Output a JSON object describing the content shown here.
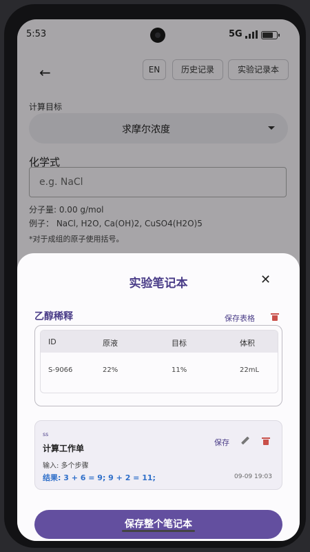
{
  "status_bar": {
    "time": "5:53",
    "network": "5G"
  },
  "header": {
    "back_icon": "arrow-left-icon",
    "back_glyph": "←",
    "chips": {
      "lang": "EN",
      "history": "历史记录",
      "notebook": "实验记录本"
    }
  },
  "form": {
    "target_label": "计算目标",
    "target_value": "求摩尔浓度",
    "formula_label": "化学式",
    "formula_placeholder": "e.g. NaCl",
    "molar_mass": "分子量: 0.00 g/mol",
    "examples": "例子： NaCl, H2O, Ca(OH)2, CuSO4(H2O)5",
    "note": "*对于成组的原子使用括号。"
  },
  "sheet": {
    "title": "实验笔记本",
    "close_glyph": "✕",
    "table_section": {
      "title": "乙醇稀释",
      "save_label": "保存表格",
      "columns": [
        "ID",
        "原液",
        "目标",
        "体积"
      ],
      "rows": [
        [
          "S-9066",
          "22%",
          "11%",
          "22mL"
        ]
      ]
    },
    "calc_card": {
      "tag": "ss",
      "title": "计算工作单",
      "save_label": "保存",
      "input": "输入: 多个步骤",
      "result": "结果: 3 + 6 = 9; 9 + 2 = 11;",
      "timestamp": "09-09 19:03"
    },
    "save_all_label": "保存整个笔记本"
  },
  "colors": {
    "accent": "#634f9f",
    "title_purple": "#4a3d88",
    "delete_red": "#c9504a",
    "result_blue": "#2f6fc9"
  }
}
